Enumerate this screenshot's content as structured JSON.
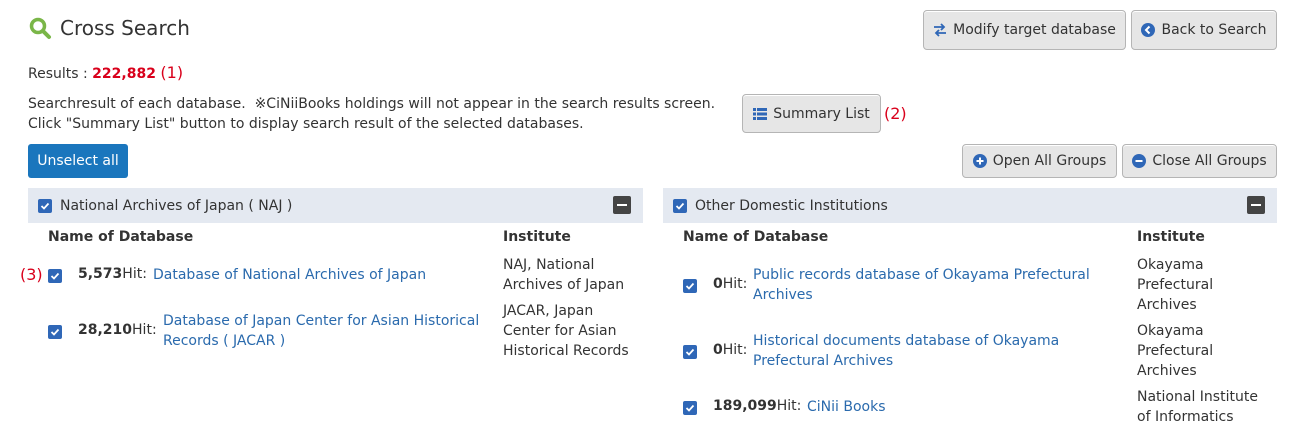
{
  "header": {
    "title": "Cross Search",
    "modify_label": "Modify target database",
    "back_label": "Back to Search"
  },
  "results": {
    "label": "Results :",
    "count": "222,882",
    "annotation": "(1)"
  },
  "description": {
    "line1": "Searchresult of each database.  ※CiNiiBooks holdings will not appear in the search results screen.",
    "line2": "Click \"Summary List\" button to display search result of the selected databases."
  },
  "summary": {
    "label": "Summary List",
    "annotation": "(2)"
  },
  "controls": {
    "unselect_label": "Unselect all",
    "open_label": "Open All Groups",
    "close_label": "Close All Groups"
  },
  "groups": [
    {
      "title": "National Archives of Japan ( NAJ )",
      "col_db": "Name of Database",
      "col_inst": "Institute",
      "rows": [
        {
          "annotation": "(3)",
          "hits": "5,573",
          "hit_suffix": "Hit:",
          "db": "Database of National Archives of Japan",
          "inst": "NAJ, National Archives of Japan"
        },
        {
          "hits": "28,210",
          "hit_suffix": "Hit:",
          "db": "Database of Japan Center for Asian Historical Records ( JACAR )",
          "inst": "JACAR, Japan Center for Asian Historical Records"
        }
      ]
    },
    {
      "title": "Other Domestic Institutions",
      "col_db": "Name of Database",
      "col_inst": "Institute",
      "rows": [
        {
          "hits": "0",
          "hit_suffix": "Hit:",
          "db": "Public records database of Okayama Prefectural Archives",
          "inst": "Okayama Prefectural Archives"
        },
        {
          "hits": "0",
          "hit_suffix": "Hit:",
          "db": "Historical documents database of Okayama Prefectural Archives",
          "inst": "Okayama Prefectural Archives"
        },
        {
          "hits": "189,099",
          "hit_suffix": "Hit:",
          "db": "CiNii Books",
          "inst": "National Institute of Informatics"
        }
      ]
    }
  ],
  "colors": {
    "accent_blue": "#1a76bd",
    "link": "#2a6aad",
    "result_red": "#d9001b",
    "search_icon_green": "#7ab648"
  }
}
